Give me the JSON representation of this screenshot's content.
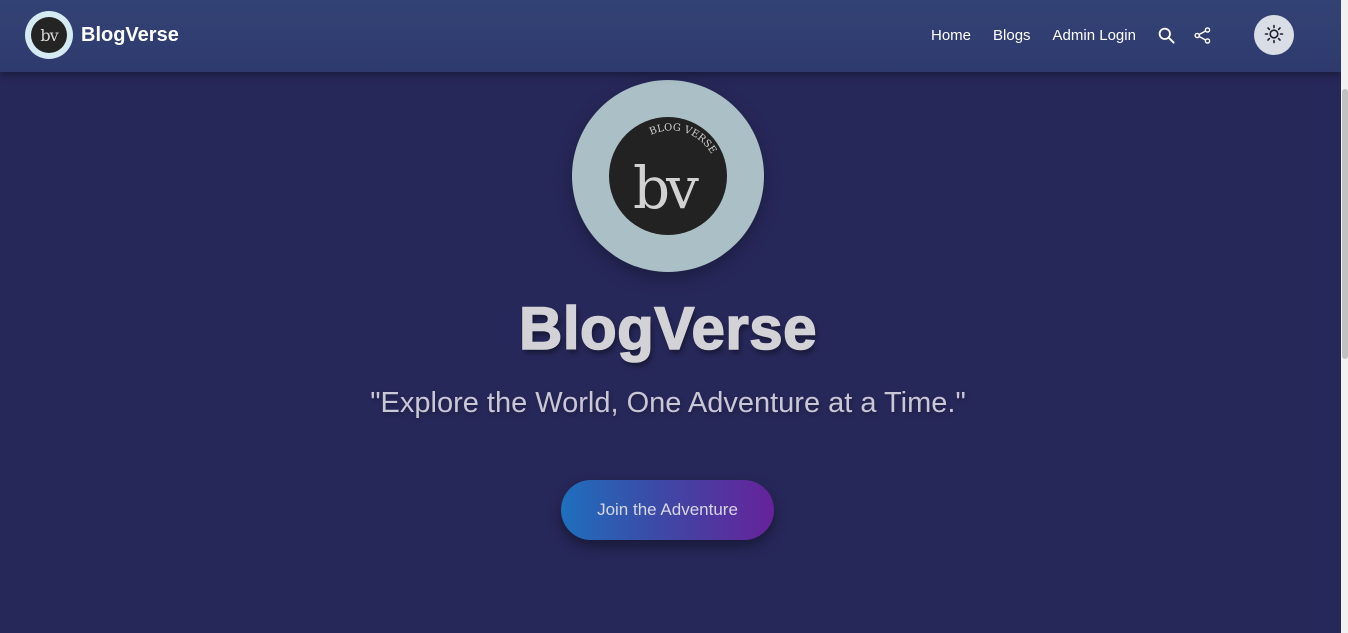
{
  "navbar": {
    "brand_name": "BlogVerse",
    "logo_text": "bv",
    "links": [
      {
        "label": "Home"
      },
      {
        "label": "Blogs"
      },
      {
        "label": "Admin Login"
      }
    ],
    "icons": [
      "search-icon",
      "share-icon",
      "sun-icon"
    ]
  },
  "hero": {
    "logo_text": "bv",
    "logo_arc_text": "BLOG VERSE",
    "title": "BlogVerse",
    "tagline": "\"Explore the World, One Adventure at a Time.\"",
    "cta_label": "Join the Adventure"
  },
  "colors": {
    "background": "#27285a",
    "navbar": "#334274",
    "cta_gradient_start": "#1f6fbd",
    "cta_gradient_end": "#66229a",
    "title_text": "#d3d2d6"
  }
}
